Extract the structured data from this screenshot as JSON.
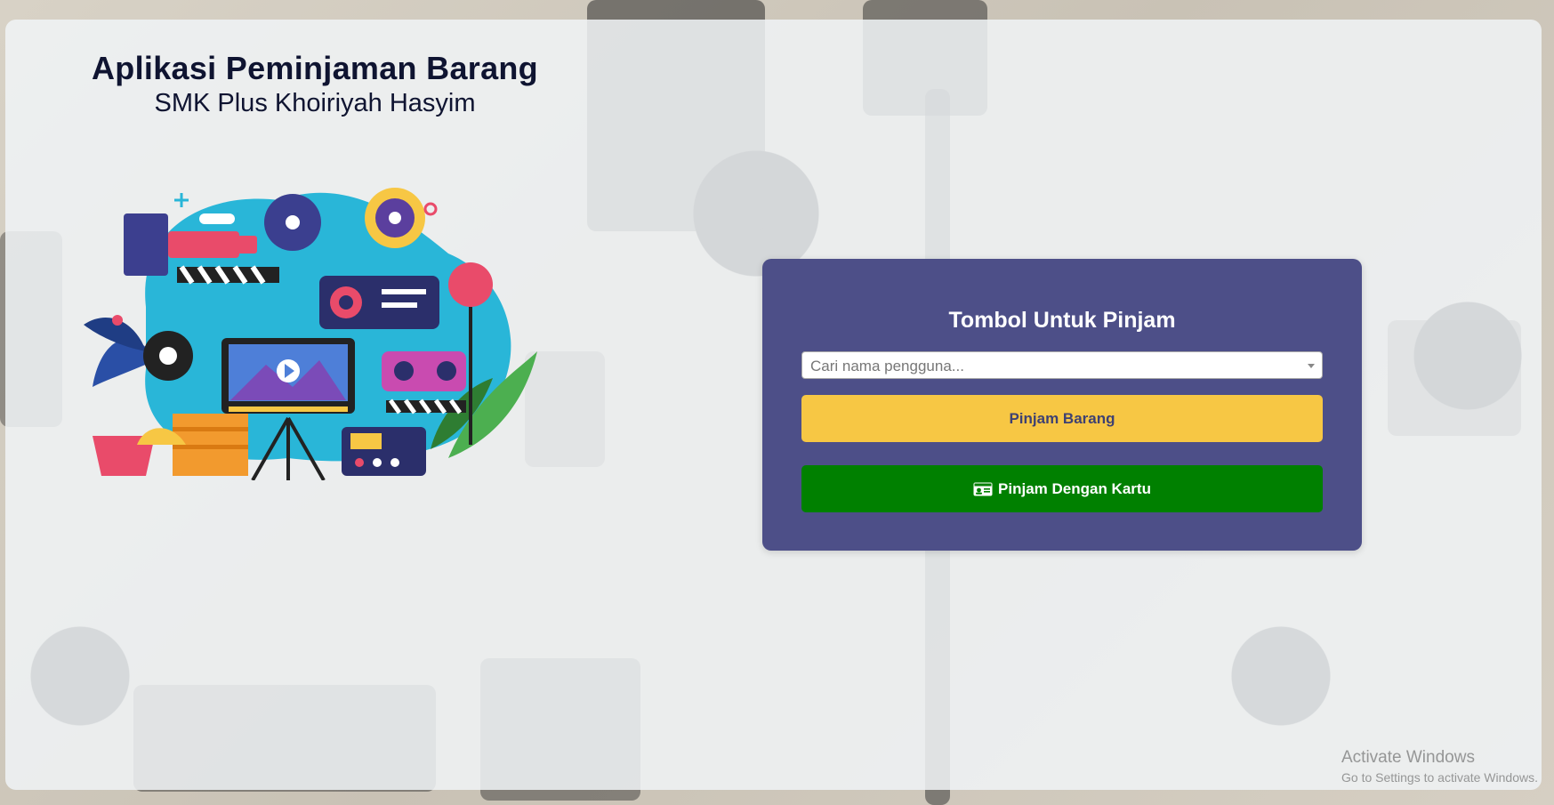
{
  "header": {
    "title": "Aplikasi Peminjaman Barang",
    "subtitle": "SMK Plus Khoiriyah Hasyim"
  },
  "panel": {
    "title": "Tombol Untuk Pinjam",
    "search_placeholder": "Cari nama pengguna...",
    "borrow_button_label": "Pinjam Barang",
    "card_button_label": "Pinjam Dengan Kartu",
    "card_button_icon": "id-card-icon"
  },
  "watermark": {
    "line1": "Activate Windows",
    "line2": "Go to Settings to activate Windows."
  },
  "colors": {
    "panel": "#4d4f88",
    "borrow_button": "#f7c744",
    "card_button": "#008000",
    "title_text": "#0f1431"
  }
}
